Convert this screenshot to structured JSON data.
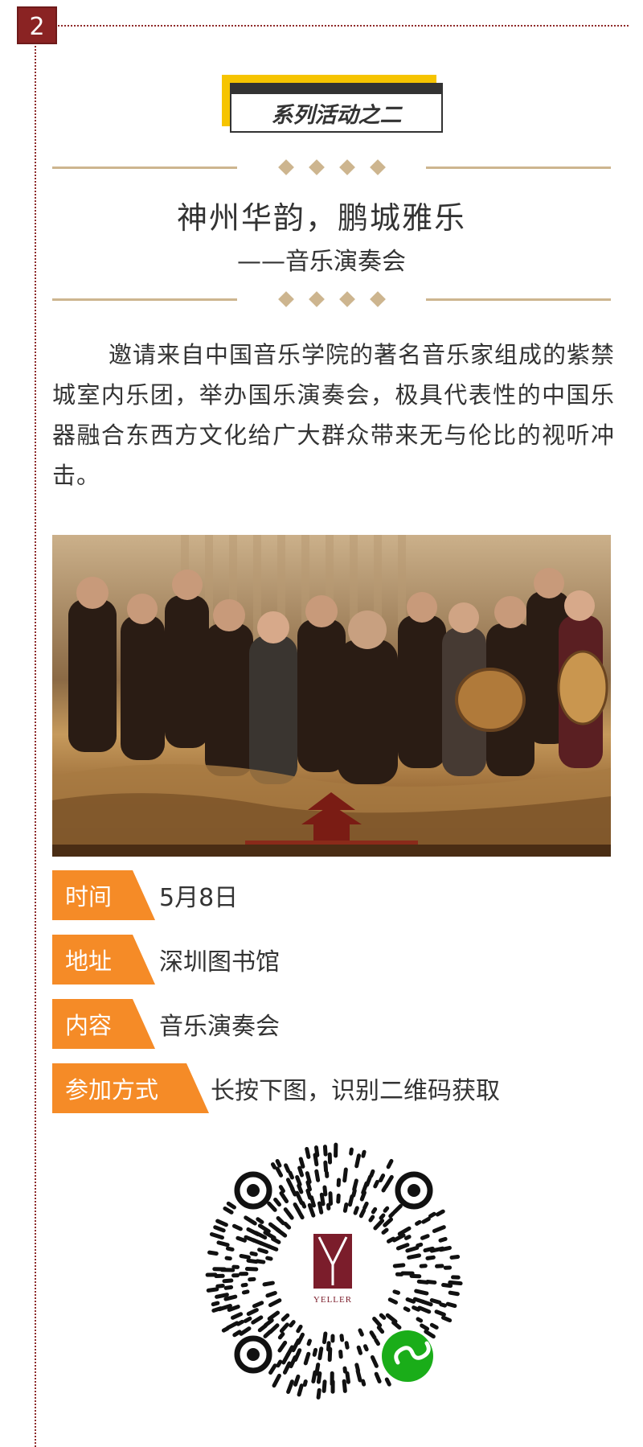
{
  "section_number": "2",
  "tag": "系列活动之二",
  "title": "神州华韵，鹏城雅乐",
  "subtitle": "——音乐演奏会",
  "intro": "邀请来自中国音乐学院的著名音乐家组成的紫禁城室内乐团，举办国乐演奏会，极具代表性的中国乐器融合东西方文化给广大群众带来无与伦比的视听冲击。",
  "info": [
    {
      "label": "时间",
      "value": "5月8日"
    },
    {
      "label": "地址",
      "value": "深圳图书馆"
    },
    {
      "label": "内容",
      "value": "音乐演奏会"
    },
    {
      "label": "参加方式",
      "value": "长按下图，识别二维码获取"
    }
  ],
  "qr_logo_text": "YELLER",
  "colors": {
    "accent_orange": "#f58b27",
    "badge_red": "#8a2323",
    "gold_line": "#cdb58f",
    "tag_yellow": "#f6c400",
    "mini_program_green": "#1aad19"
  },
  "icons": [
    "mini-program-icon",
    "yeller-logo"
  ]
}
